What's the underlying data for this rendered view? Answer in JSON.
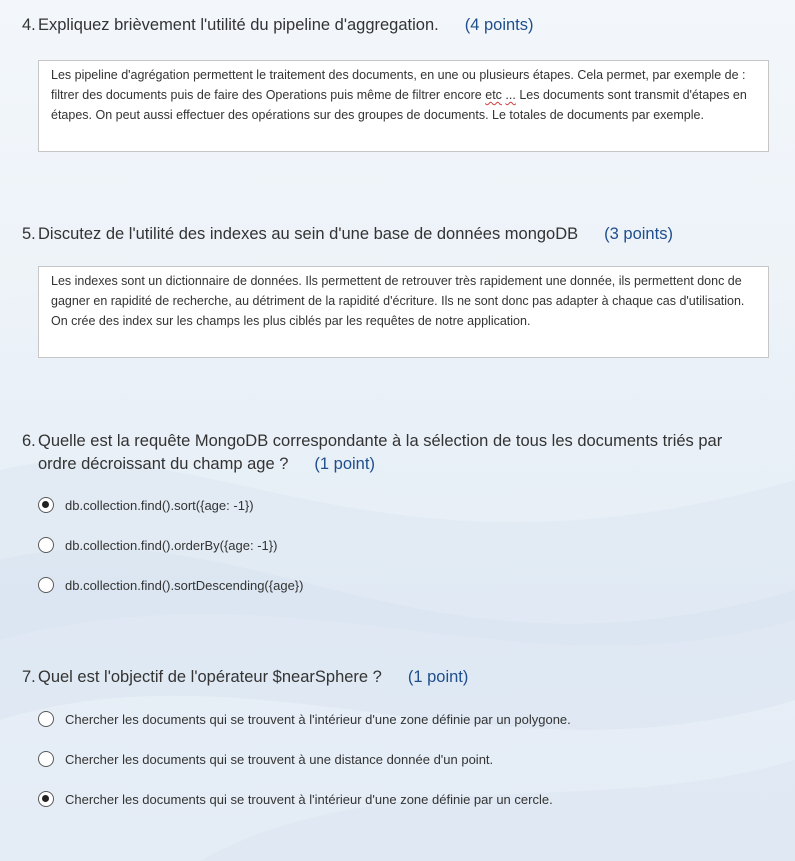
{
  "questions": [
    {
      "number": "4.",
      "text": "Expliquez brièvement l'utilité du pipeline d'aggregation.",
      "points": "(4 points)",
      "answer_parts": [
        "Les pipeline d'agrégation permettent le traitement des documents, en une ou plusieurs étapes. Cela permet, par exemple de : filtrer des documents puis de faire des Operations puis même de filtrer encore ",
        "etc",
        " ",
        "...",
        " Les documents sont transmit d'étapes en étapes. On peut aussi effectuer des opérations sur des groupes de documents. Le totales de documents par exemple."
      ]
    },
    {
      "number": "5.",
      "text": "Discutez de l'utilité des indexes au sein d'une base de données mongoDB",
      "points": "(3 points)",
      "answer": "Les indexes sont un dictionnaire de données. Ils permettent de retrouver très rapidement une donnée, ils permettent donc de gagner en rapidité de recherche, au détriment de la rapidité d'écriture. Ils ne sont donc pas adapter à chaque cas d'utilisation. On crée des index sur les champs les plus ciblés par les requêtes de notre application."
    },
    {
      "number": "6.",
      "text": "Quelle est la requête MongoDB correspondante à la sélection de tous les documents triés par ordre décroissant du champ age ?",
      "points": "(1 point)",
      "options": [
        {
          "label": "db.collection.find().sort({age: -1})",
          "selected": true
        },
        {
          "label": "db.collection.find().orderBy({age: -1})",
          "selected": false
        },
        {
          "label": "db.collection.find().sortDescending({age})",
          "selected": false
        }
      ]
    },
    {
      "number": "7.",
      "text": "Quel est l'objectif de l'opérateur $nearSphere ?",
      "points": "(1 point)",
      "options": [
        {
          "label": "Chercher les documents qui se trouvent à l'intérieur d'une zone définie par un polygone.",
          "selected": false
        },
        {
          "label": "Chercher les documents qui se trouvent à une distance donnée d'un point.",
          "selected": false
        },
        {
          "label": "Chercher les documents qui se trouvent à l'intérieur d'une zone définie par un cercle.",
          "selected": true
        }
      ]
    }
  ],
  "colors": {
    "points": "#1f4e8c",
    "background": "#eaf1f8",
    "text": "#333333",
    "spellcheck": "#d23b3b"
  }
}
